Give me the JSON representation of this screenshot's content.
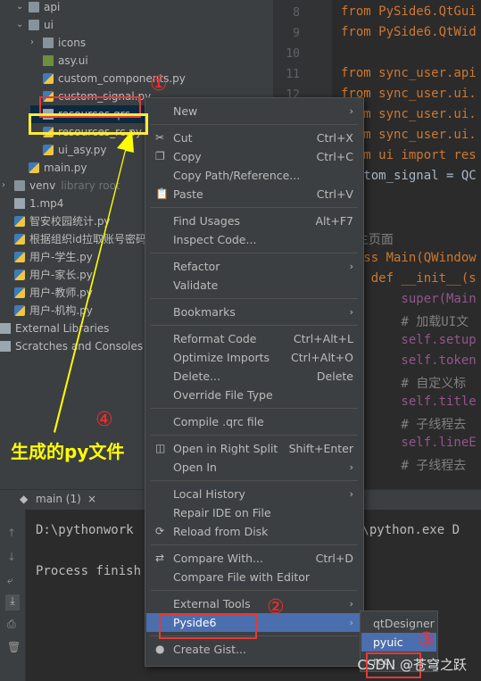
{
  "tree": [
    {
      "label": "api",
      "type": "folder",
      "depth": 1,
      "expanded": true
    },
    {
      "label": "ui",
      "type": "folder",
      "depth": 1,
      "expanded": true
    },
    {
      "label": "icons",
      "type": "folder",
      "depth": 2,
      "expanded": false
    },
    {
      "label": "asy.ui",
      "type": "ui",
      "depth": 2
    },
    {
      "label": "custom_components.py",
      "type": "py",
      "depth": 2
    },
    {
      "label": "custom_signal.py",
      "type": "py",
      "depth": 2
    },
    {
      "label": "resources.qrc",
      "type": "qrc",
      "depth": 2,
      "selected": true
    },
    {
      "label": "resources_rc.py",
      "type": "py",
      "depth": 2
    },
    {
      "label": "ui_asy.py",
      "type": "py",
      "depth": 2
    },
    {
      "label": "main.py",
      "type": "py",
      "depth": 1
    },
    {
      "label": "venv",
      "type": "folder",
      "depth": 0,
      "expanded": false,
      "hint": "library root"
    },
    {
      "label": "1.mp4",
      "type": "file",
      "depth": 0
    },
    {
      "label": "智安校园统计.py",
      "type": "py",
      "depth": 0
    },
    {
      "label": "根据组织id拉取账号密码",
      "type": "py",
      "depth": 0
    },
    {
      "label": "用户-学生.py",
      "type": "py",
      "depth": 0
    },
    {
      "label": "用户-家长.py",
      "type": "py",
      "depth": 0
    },
    {
      "label": "用户-教师.py",
      "type": "py",
      "depth": 0
    },
    {
      "label": "用户-机构.py",
      "type": "py",
      "depth": 0
    },
    {
      "label": "External Libraries",
      "type": "lib",
      "depth": -1
    },
    {
      "label": "Scratches and Consoles",
      "type": "scratch",
      "depth": -1
    }
  ],
  "gutter": [
    "8",
    "9",
    "10",
    "11",
    "12",
    "13",
    "14",
    "15",
    "16",
    "17"
  ],
  "code": [
    "from PySide6.QtGui",
    "from PySide6.QtWid",
    "",
    "from sync_user.api",
    "from sync_user.ui.",
    "from sync_user.ui.",
    "from sync_user.ui.",
    "from ui import res",
    "custom_signal = QC",
    "",
    "",
    "# 主页面",
    "class Main(QWindow",
    "    def __init__(s",
    "        super(Main",
    "        # 加载UI文",
    "        self.setup",
    "        self.token",
    "        # 自定义标",
    "        self.title",
    "        # 子线程去",
    "        self.lineE",
    "        # 子线程去"
  ],
  "run_tab": "main (1)",
  "terminal": {
    "line1": "D:\\pythonwork",
    "line1_tail": "s\\python.exe D",
    "line2": "Process finish"
  },
  "menu": [
    {
      "label": "New",
      "shortcut": "",
      "submenu": true
    },
    {
      "sep": true
    },
    {
      "label": "Cut",
      "shortcut": "Ctrl+X",
      "icon": "scissors-icon",
      "glyph": "✂"
    },
    {
      "label": "Copy",
      "shortcut": "Ctrl+C",
      "icon": "copy-icon",
      "glyph": "❐"
    },
    {
      "label": "Copy Path/Reference...",
      "shortcut": ""
    },
    {
      "label": "Paste",
      "shortcut": "Ctrl+V",
      "icon": "paste-icon",
      "glyph": "📋"
    },
    {
      "sep": true
    },
    {
      "label": "Find Usages",
      "shortcut": "Alt+F7"
    },
    {
      "label": "Inspect Code...",
      "shortcut": ""
    },
    {
      "sep": true
    },
    {
      "label": "Refactor",
      "shortcut": "",
      "submenu": true
    },
    {
      "label": "Validate",
      "shortcut": ""
    },
    {
      "sep": true
    },
    {
      "label": "Bookmarks",
      "shortcut": "",
      "submenu": true
    },
    {
      "sep": true
    },
    {
      "label": "Reformat Code",
      "shortcut": "Ctrl+Alt+L"
    },
    {
      "label": "Optimize Imports",
      "shortcut": "Ctrl+Alt+O"
    },
    {
      "label": "Delete...",
      "shortcut": "Delete"
    },
    {
      "label": "Override File Type",
      "shortcut": ""
    },
    {
      "sep": true
    },
    {
      "label": "Compile .qrc file",
      "shortcut": ""
    },
    {
      "sep": true
    },
    {
      "label": "Open in Right Split",
      "shortcut": "Shift+Enter",
      "icon": "split-icon",
      "glyph": "◫"
    },
    {
      "label": "Open In",
      "shortcut": "",
      "submenu": true
    },
    {
      "sep": true
    },
    {
      "label": "Local History",
      "shortcut": "",
      "submenu": true
    },
    {
      "label": "Repair IDE on File",
      "shortcut": ""
    },
    {
      "label": "Reload from Disk",
      "shortcut": "",
      "icon": "reload-icon",
      "glyph": "⟳"
    },
    {
      "sep": true
    },
    {
      "label": "Compare With...",
      "shortcut": "Ctrl+D",
      "icon": "compare-icon",
      "glyph": "⇄"
    },
    {
      "label": "Compare File with Editor",
      "shortcut": ""
    },
    {
      "sep": true
    },
    {
      "label": "External Tools",
      "shortcut": "",
      "submenu": true
    },
    {
      "label": "Pyside6",
      "shortcut": "",
      "submenu": true,
      "highlight": true
    },
    {
      "sep": true
    },
    {
      "label": "Create Gist...",
      "shortcut": "",
      "icon": "github-icon",
      "glyph": "●"
    }
  ],
  "submenu": [
    {
      "label": "qtDesigner",
      "highlight": false
    },
    {
      "label": "pyuic",
      "highlight": true
    },
    {
      "label": "rcc",
      "highlight": false
    }
  ],
  "annotations": {
    "c1": "①",
    "c2": "②",
    "c3": "③",
    "c4": "④",
    "caption": "生成的py文件"
  },
  "watermark": "CSDN @苍穹之跃",
  "colors": {
    "accent": "#4b6eaf",
    "annotation_red": "#e53935",
    "annotation_yellow": "#ffeb3b"
  }
}
